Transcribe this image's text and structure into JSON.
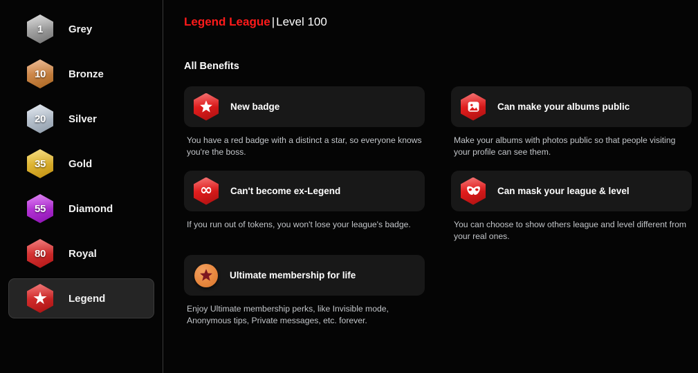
{
  "sidebar": {
    "items": [
      {
        "badge": "1",
        "label": "Grey",
        "icon": "hexagon-badge-grey",
        "color_start": "#cfcfcf",
        "color_end": "#6f6f6f",
        "selected": false
      },
      {
        "badge": "10",
        "label": "Bronze",
        "icon": "hexagon-badge-bronze",
        "color_start": "#e8a06a",
        "color_end": "#a8651f",
        "selected": false
      },
      {
        "badge": "20",
        "label": "Silver",
        "icon": "hexagon-badge-silver",
        "color_start": "#d8e0ea",
        "color_end": "#8d9aa8",
        "selected": false
      },
      {
        "badge": "35",
        "label": "Gold",
        "icon": "hexagon-badge-gold",
        "color_start": "#f5d250",
        "color_end": "#c08f10",
        "selected": false
      },
      {
        "badge": "55",
        "label": "Diamond",
        "icon": "hexagon-badge-diamond",
        "color_start": "#d24ff0",
        "color_end": "#8a0fb0",
        "selected": false
      },
      {
        "badge": "80",
        "label": "Royal",
        "icon": "hexagon-badge-royal",
        "color_start": "#f04a4a",
        "color_end": "#b01414",
        "selected": false
      },
      {
        "badge": "star",
        "label": "Legend",
        "icon": "hexagon-badge-legend",
        "color_start": "#f04040",
        "color_end": "#a81010",
        "selected": true
      }
    ]
  },
  "header": {
    "league_name": "Legend League",
    "separator": "|",
    "level": "Level 100",
    "league_color": "#ff1a1a"
  },
  "main": {
    "benefits_heading": "All Benefits",
    "benefits": [
      {
        "icon": "star-hexagon-icon",
        "title": "New badge",
        "description": "You have a red badge with a distinct a star, so everyone knows you're the boss."
      },
      {
        "icon": "photo-hexagon-icon",
        "title": "Can make your albums public",
        "description": "Make your albums with photos public so that people visiting your profile can see them."
      },
      {
        "icon": "infinity-hexagon-icon",
        "title": "Can't become ex-Legend",
        "description": "If you run out of tokens, you won't lose your league's badge."
      },
      {
        "icon": "mask-hexagon-icon",
        "title": "Can mask your league & level",
        "description": "You can choose to show others league and level different from your real ones."
      },
      {
        "icon": "star-circle-icon",
        "title": "Ultimate membership for life",
        "description": "Enjoy Ultimate membership perks, like Invisible mode, Anonymous tips, Private messages, etc. forever."
      }
    ]
  },
  "colors": {
    "background": "#050505",
    "card_background": "#181818",
    "selected_item_background": "#252525",
    "accent_red": "#e01c1c",
    "accent_orange": "#e8883f",
    "description_text": "#c3c6ca"
  }
}
